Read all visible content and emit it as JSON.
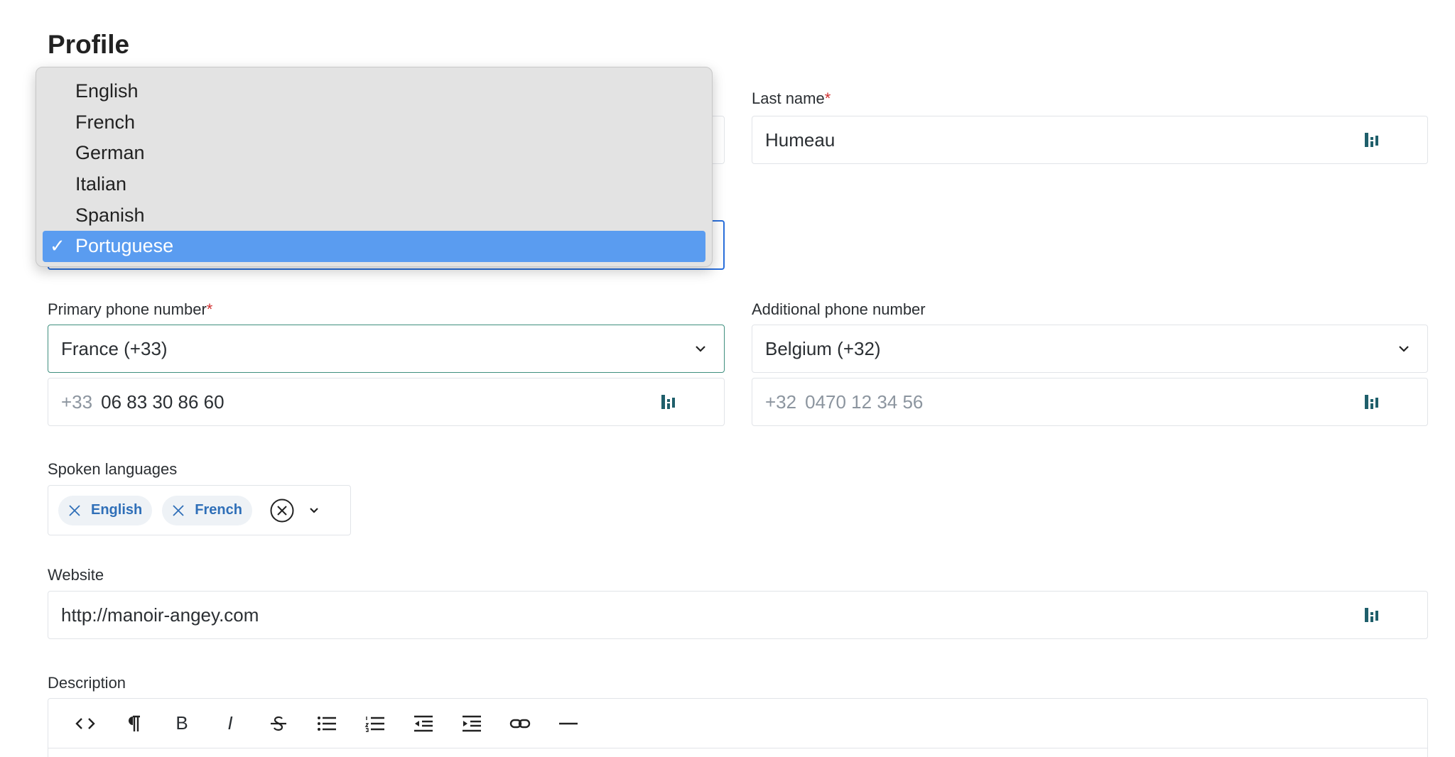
{
  "page": {
    "title": "Profile"
  },
  "colors": {
    "accent": "#2a6fdb",
    "selected_option": "#5a9cf0",
    "focus_green": "#3f8f7e",
    "tag_text": "#2f6fb8",
    "required": "#d03030"
  },
  "language_dropdown": {
    "options": [
      {
        "label": "English"
      },
      {
        "label": "French"
      },
      {
        "label": "German"
      },
      {
        "label": "Italian"
      },
      {
        "label": "Spanish"
      },
      {
        "label": "Portuguese",
        "check": "✓"
      }
    ],
    "selected": "Portuguese"
  },
  "last_name": {
    "label": "Last name",
    "required_mark": "*",
    "value": "Humeau"
  },
  "primary_phone": {
    "label": "Primary phone number",
    "required_mark": "*",
    "country": "France (+33)",
    "prefix": "+33",
    "number": "06 83 30 86 60"
  },
  "additional_phone": {
    "label": "Additional phone number",
    "country": "Belgium (+32)",
    "prefix": "+32",
    "placeholder": "0470 12 34 56"
  },
  "spoken_languages": {
    "label": "Spoken languages",
    "tags": [
      "English",
      "French"
    ]
  },
  "website": {
    "label": "Website",
    "value": "http://manoir-angey.com"
  },
  "description": {
    "label": "Description",
    "toolbar": [
      "code-view",
      "paragraph",
      "B",
      "I",
      "strikethrough",
      "bullet-list",
      "ordered-list",
      "outdent",
      "indent",
      "link",
      "horizontal-rule"
    ]
  }
}
